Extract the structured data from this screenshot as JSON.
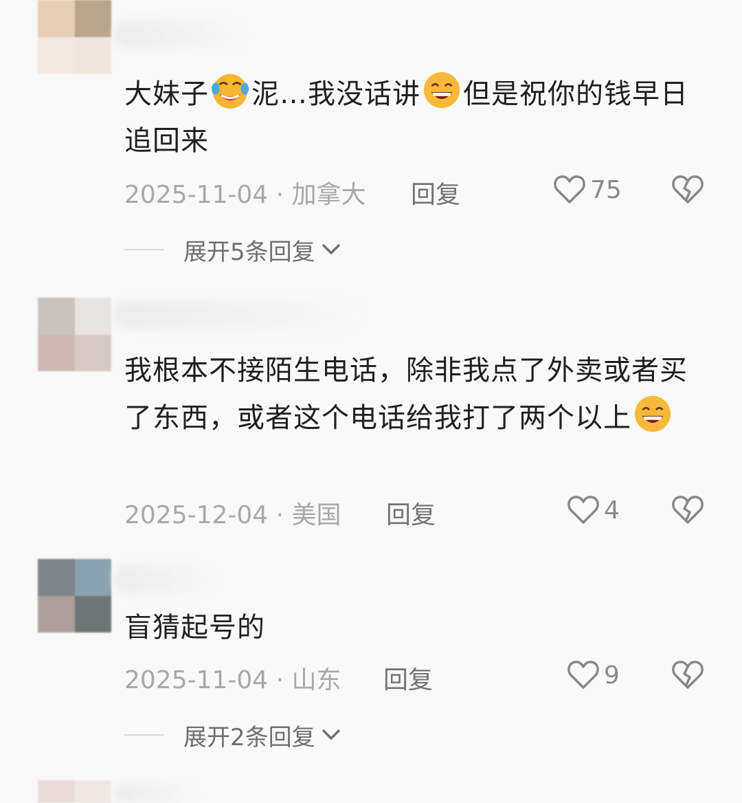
{
  "comments": [
    {
      "text_parts": [
        "大妹子",
        "泥…我没话讲",
        "但是祝你的钱早日追回来"
      ],
      "date_location": "2025-11-04 · 加拿大",
      "reply_label": "回复",
      "likes": "75",
      "expand_label": "展开5条回复"
    },
    {
      "text_parts": [
        "我根本不接陌生电话，除非我点了外卖或者买了东西，或者这个电话给我打了两个以上"
      ],
      "date_location": "2025-12-04 · 美国",
      "reply_label": "回复",
      "likes": "4"
    },
    {
      "text_parts": [
        "盲猜起号的"
      ],
      "date_location": "2025-11-04 · 山东",
      "reply_label": "回复",
      "likes": "9",
      "expand_label": "展开2条回复"
    }
  ],
  "icons": {
    "like": "heart-outline-icon",
    "dislike": "broken-heart-icon",
    "expand": "chevron-down-icon",
    "emoji_laugh": "rolling-laugh-emoji",
    "emoji_grin": "grinning-squint-emoji"
  }
}
